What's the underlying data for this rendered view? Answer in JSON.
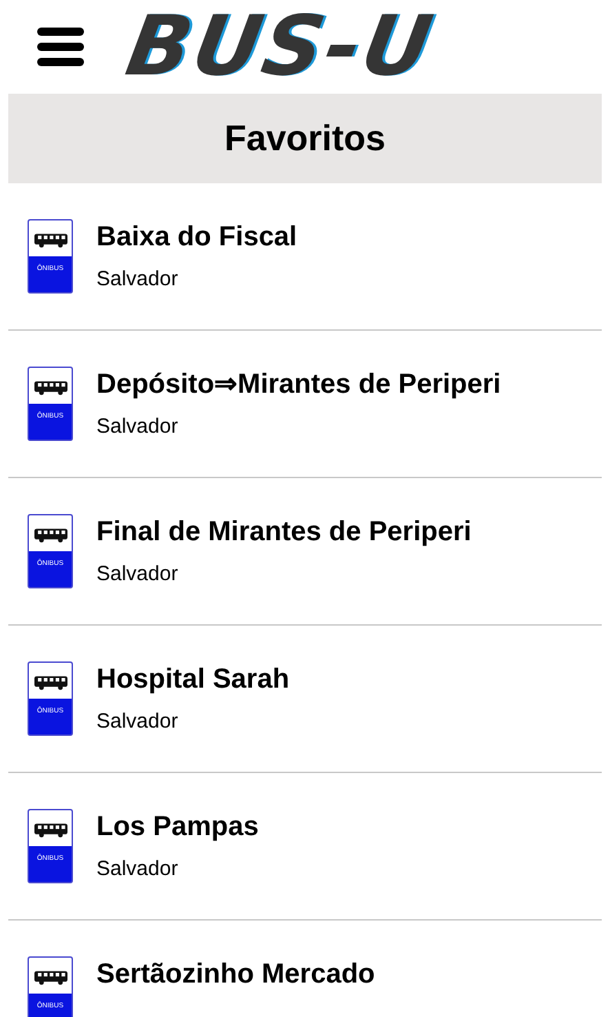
{
  "header": {
    "logo": "BUS-U"
  },
  "section_title": "Favoritos",
  "favorites": [
    {
      "name": "Baixa do Fiscal",
      "city": "Salvador",
      "sign": "ÔNIBUS"
    },
    {
      "name": "Depósito⇒Mirantes de Periperi",
      "city": "Salvador",
      "sign": "ÔNIBUS"
    },
    {
      "name": "Final de Mirantes de Periperi",
      "city": "Salvador",
      "sign": "ÔNIBUS"
    },
    {
      "name": "Hospital Sarah",
      "city": "Salvador",
      "sign": "ÔNIBUS"
    },
    {
      "name": "Los Pampas",
      "city": "Salvador",
      "sign": "ÔNIBUS"
    },
    {
      "name": "Sertãozinho Mercado",
      "sign": "ÔNIBUS"
    }
  ]
}
